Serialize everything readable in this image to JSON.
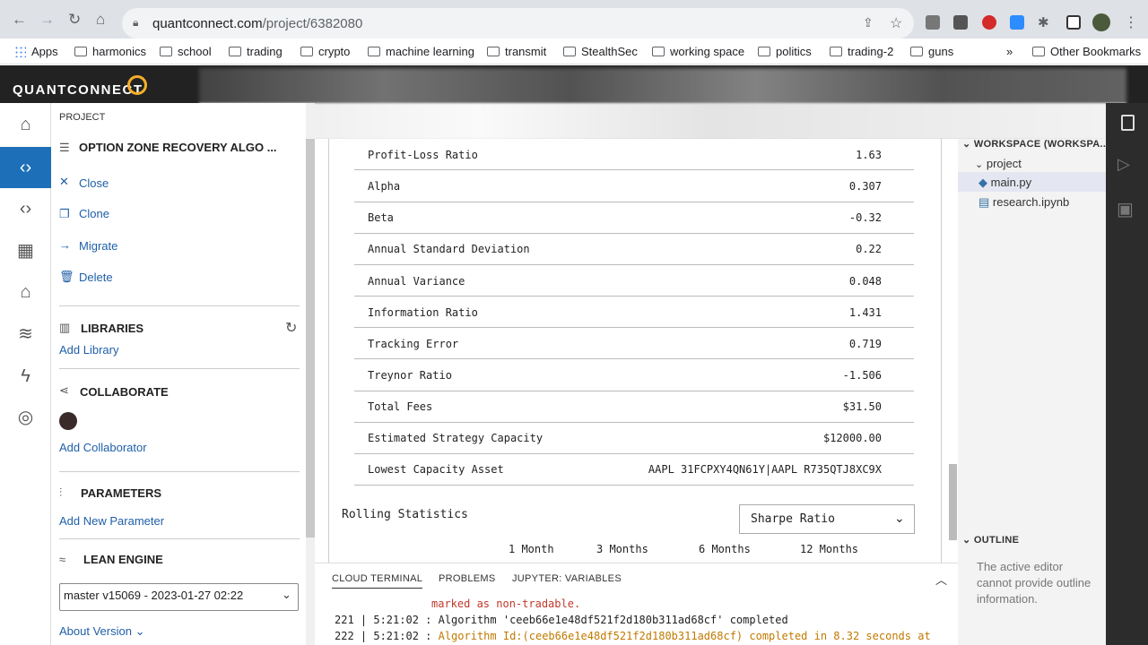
{
  "browser": {
    "url_domain": "quantconnect.com",
    "url_path": "/project/6382080",
    "bookmarks": [
      "Apps",
      "harmonics",
      "school",
      "trading",
      "crypto",
      "machine learning",
      "transmit",
      "StealthSec",
      "working space",
      "politics",
      "trading-2",
      "guns"
    ],
    "bookmarks_overflow": "»",
    "other_bookmarks": "Other Bookmarks"
  },
  "app": {
    "logo_main": "QUANTCONNECT",
    "logo_icon": "ring-logo-icon"
  },
  "rail": {
    "icons": [
      "home-icon",
      "code-icon",
      "code-icon",
      "building-icon",
      "graduation-icon",
      "database-icon",
      "lightning-icon",
      "lifebuoy-icon"
    ]
  },
  "project": {
    "section": "PROJECT",
    "name": "OPTION ZONE RECOVERY ALGO ...",
    "actions": [
      "Close",
      "Clone",
      "Migrate",
      "Delete"
    ],
    "libraries_title": "LIBRARIES",
    "add_library": "Add Library",
    "collaborate_title": "COLLABORATE",
    "add_collaborator": "Add Collaborator",
    "parameters_title": "PARAMETERS",
    "add_parameter": "Add New Parameter",
    "lean_title": "LEAN ENGINE",
    "lean_version": "master v15069 - 2023-01-27 02:22",
    "about_version": "About Version"
  },
  "stats": [
    {
      "label": "Profit-Loss Ratio",
      "value": "1.63"
    },
    {
      "label": "Alpha",
      "value": "0.307"
    },
    {
      "label": "Beta",
      "value": "-0.32"
    },
    {
      "label": "Annual Standard Deviation",
      "value": "0.22"
    },
    {
      "label": "Annual Variance",
      "value": "0.048"
    },
    {
      "label": "Information Ratio",
      "value": "1.431"
    },
    {
      "label": "Tracking Error",
      "value": "0.719"
    },
    {
      "label": "Treynor Ratio",
      "value": "-1.506"
    },
    {
      "label": "Total Fees",
      "value": "$31.50"
    },
    {
      "label": "Estimated Strategy Capacity",
      "value": "$12000.00"
    },
    {
      "label": "Lowest Capacity Asset",
      "value": "AAPL 31FCPXY4QN61Y|AAPL R735QTJ8XC9X"
    }
  ],
  "rolling": {
    "title": "Rolling Statistics",
    "selected": "Sharpe Ratio",
    "columns": [
      "1 Month",
      "3 Months",
      "6 Months",
      "12 Months"
    ]
  },
  "terminal": {
    "tabs": [
      "CLOUD TERMINAL",
      "PROBLEMS",
      "JUPYTER: VARIABLES"
    ],
    "lines": [
      {
        "text": "marked as non-tradable.",
        "color": "#c0392b"
      },
      {
        "prefix": "221 | 5:21:02 : ",
        "text": "Algorithm 'ceeb66e1e48df521f2d180b311ad68cf' completed",
        "color": "#222222"
      },
      {
        "prefix": "222 | 5:21:02 : ",
        "text": "Algorithm Id:(ceeb66e1e48df521f2d180b311ad68cf) completed in 8.32 seconds at",
        "color": "#c07a00"
      }
    ]
  },
  "workspace": {
    "title": "WORKSPACE (WORKSPA...",
    "folder": "project",
    "files": [
      "main.py",
      "research.ipynb"
    ],
    "outline_title": "OUTLINE",
    "outline_msg": "The active editor cannot provide outline information."
  }
}
